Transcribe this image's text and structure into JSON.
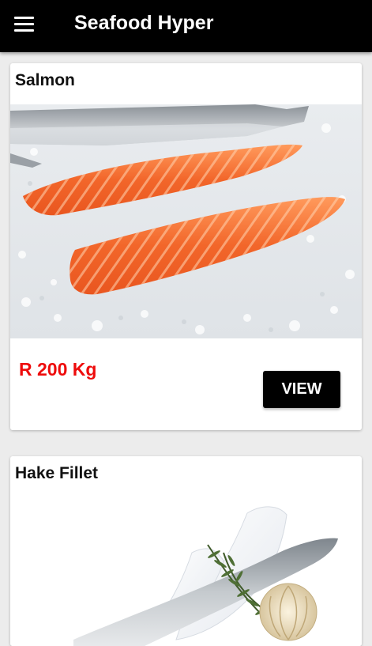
{
  "app": {
    "title": "Seafood Hyper"
  },
  "products": [
    {
      "name": "Salmon",
      "price": "R 200 Kg",
      "view_label": "VIEW"
    },
    {
      "name": "Hake Fillet"
    }
  ],
  "colors": {
    "appbar": "#000000",
    "price": "#ee0c0c",
    "button": "#000000",
    "background": "#ececec"
  }
}
